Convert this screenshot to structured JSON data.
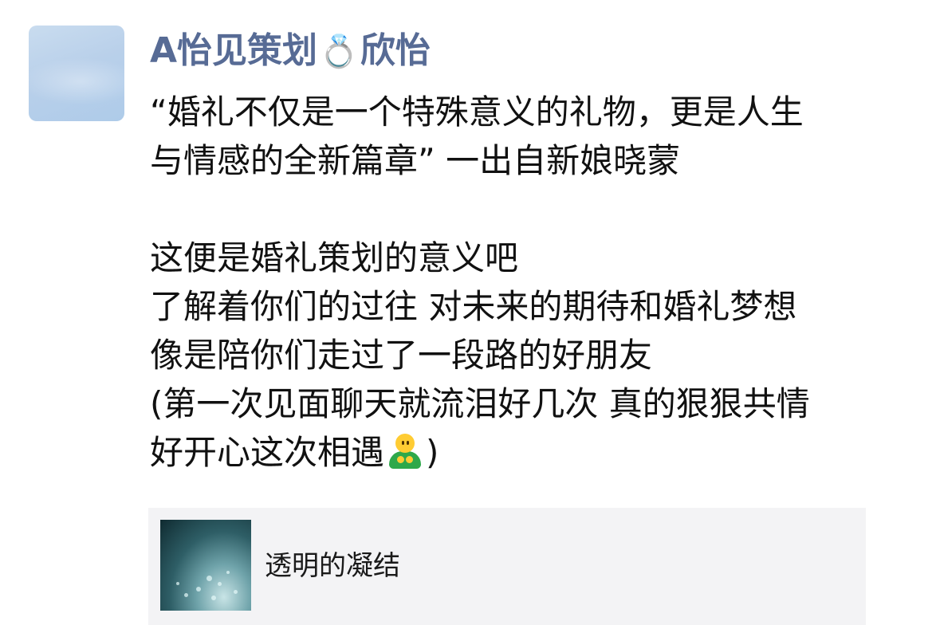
{
  "post": {
    "author_name_prefix": "A怡见策划",
    "author_name_emoji": "💍",
    "author_name_suffix": "欣怡",
    "content_lines": [
      "“婚礼不仅是一个特殊意义的礼物，更是人生",
      "与情感的全新篇章” 一出自新娘晓蒙",
      "",
      "这便是婚礼策划的意义吧",
      "了解着你们的过往 对未来的期待和婚礼梦想",
      "像是陪你们走过了一段路的好朋友",
      "(第一次见面聊天就流泪好几次 真的狠狠共情"
    ],
    "last_line_before_emoji": "好开心这次相遇",
    "last_line_after_emoji": ")",
    "emoji_icon": "person-emoji",
    "share_card": {
      "title": "透明的凝结",
      "thumbnail_icon": "water-droplets-image"
    }
  },
  "colors": {
    "nickname": "#576b95",
    "text": "#111111",
    "card_background": "#f3f3f5"
  }
}
